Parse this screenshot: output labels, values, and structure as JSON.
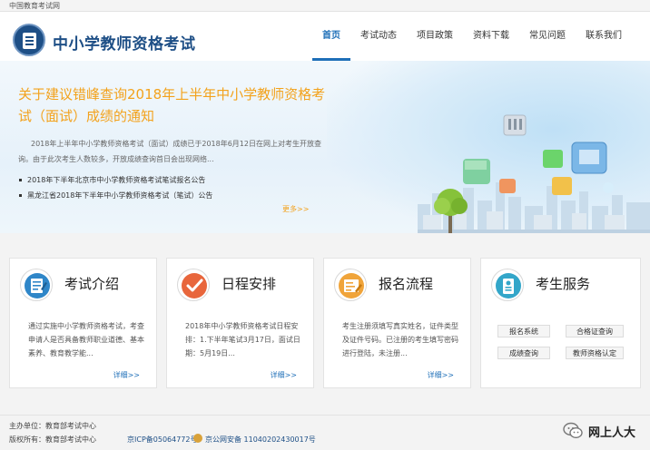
{
  "topbar": {
    "site_label": "中国教育考试网"
  },
  "header": {
    "title": "中小学教师资格考试",
    "nav": [
      "首页",
      "考试动态",
      "项目政策",
      "资料下载",
      "常见问题",
      "联系我们"
    ]
  },
  "banner": {
    "headline": "关于建议错峰查询2018年上半年中小学教师资格考试（面试）成绩的通知",
    "summary": "2018年上半年中小学教师资格考试（面试）成绩已于2018年6月12日在网上对考生开放查询。由于此次考生人数较多，开放成绩查询首日会出现网络...",
    "bullets": [
      "2018年下半年北京市中小学教师资格考试笔试报名公告",
      "黑龙江省2018年下半年中小学教师资格考试（笔试）公告"
    ],
    "more": "更多>>"
  },
  "cards": [
    {
      "icon": "notepad-icon",
      "title": "考试介绍",
      "text": "通过实施中小学教师资格考试，考查申请人是否具备教师职业道德、基本素养、教育教学能...",
      "more": "详细>>"
    },
    {
      "icon": "checkmark-icon",
      "title": "日程安排",
      "text": "2018年中小学教师资格考试日程安排：1.下半年笔试3月17日，面试日期：5月19日...",
      "more": "详细>>"
    },
    {
      "icon": "form-icon",
      "title": "报名流程",
      "text": "考生注册须填写真实姓名，证件类型及证件号码。已注册的考生填写密码进行登陆，未注册...",
      "more": "详细>>"
    },
    {
      "icon": "id-card-icon",
      "title": "考生服务",
      "buttons": [
        "报名系统",
        "合格证查询",
        "成绩查询",
        "教师资格认定"
      ]
    }
  ],
  "footer": {
    "sponsor": "主办单位：教育部考试中心",
    "copyright": "版权所有：教育部考试中心",
    "icp": "京ICP备05064772号",
    "police": "京公网安备 11040202430017号",
    "wechat": "网上人大"
  },
  "colors": {
    "brand": "#1e4f86",
    "accent": "#f3a21c",
    "link": "#1e6fb8"
  }
}
